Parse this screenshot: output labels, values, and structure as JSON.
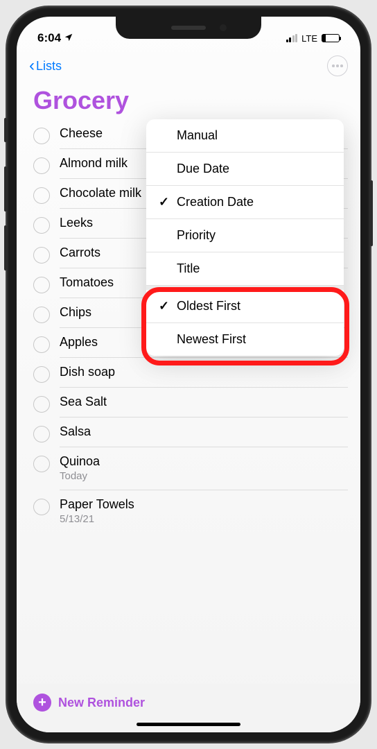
{
  "status": {
    "time": "6:04",
    "network": "LTE"
  },
  "nav": {
    "back_label": "Lists"
  },
  "list": {
    "title": "Grocery",
    "accent_color": "#af52de"
  },
  "reminders": [
    {
      "title": "Cheese",
      "sub": ""
    },
    {
      "title": "Almond milk",
      "sub": ""
    },
    {
      "title": "Chocolate milk",
      "sub": ""
    },
    {
      "title": "Leeks",
      "sub": ""
    },
    {
      "title": "Carrots",
      "sub": ""
    },
    {
      "title": "Tomatoes",
      "sub": ""
    },
    {
      "title": "Chips",
      "sub": ""
    },
    {
      "title": "Apples",
      "sub": ""
    },
    {
      "title": "Dish soap",
      "sub": ""
    },
    {
      "title": "Sea Salt",
      "sub": ""
    },
    {
      "title": "Salsa",
      "sub": ""
    },
    {
      "title": "Quinoa",
      "sub": "Today"
    },
    {
      "title": "Paper Towels",
      "sub": "5/13/21"
    }
  ],
  "footer": {
    "new_reminder_label": "New Reminder"
  },
  "popover": {
    "sort_options": [
      {
        "label": "Manual",
        "checked": false
      },
      {
        "label": "Due Date",
        "checked": false
      },
      {
        "label": "Creation Date",
        "checked": true
      },
      {
        "label": "Priority",
        "checked": false
      },
      {
        "label": "Title",
        "checked": false
      }
    ],
    "order_options": [
      {
        "label": "Oldest First",
        "checked": true
      },
      {
        "label": "Newest First",
        "checked": false
      }
    ]
  }
}
